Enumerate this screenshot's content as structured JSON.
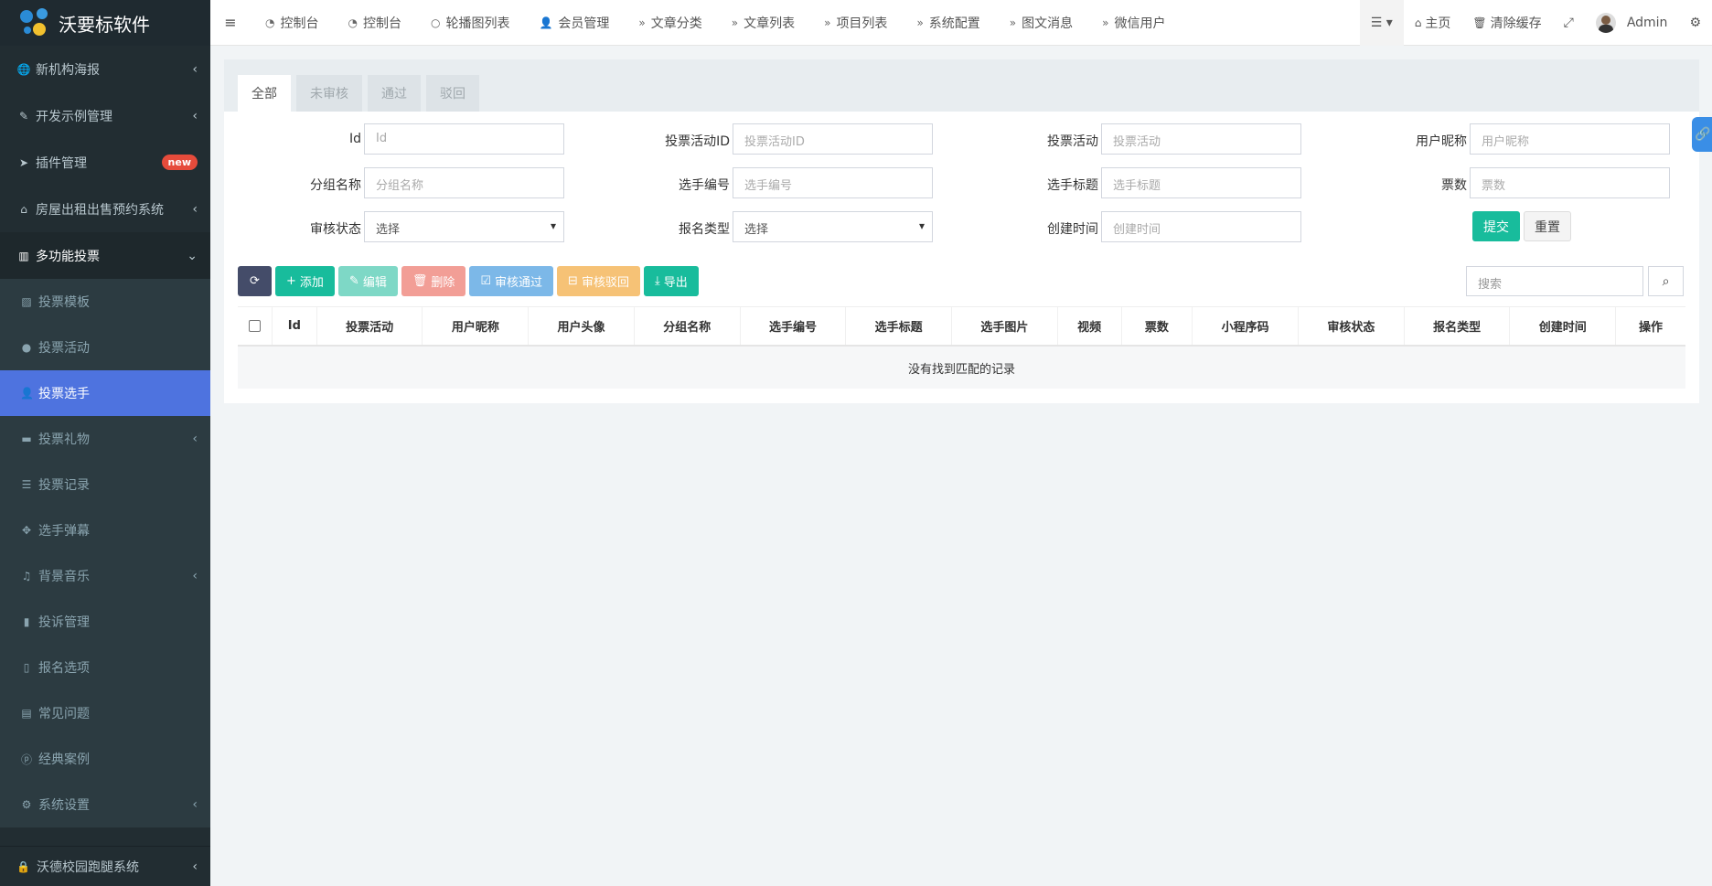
{
  "app": {
    "title": "沃要标软件"
  },
  "sidebar": {
    "items": [
      {
        "label": "新机构海报",
        "icon": "globe-icon",
        "glyph": "🌐"
      },
      {
        "label": "开发示例管理",
        "icon": "magic-icon",
        "glyph": "✎"
      },
      {
        "label": "插件管理",
        "icon": "rocket-icon",
        "glyph": "➤",
        "badge": "new"
      },
      {
        "label": "房屋出租出售预约系统",
        "icon": "home-icon",
        "glyph": "⌂"
      },
      {
        "label": "多功能投票",
        "icon": "columns-icon",
        "glyph": "▥"
      }
    ],
    "subitems": [
      {
        "label": "投票模板",
        "icon": "image-icon",
        "glyph": "▨"
      },
      {
        "label": "投票活动",
        "icon": "bomb-icon",
        "glyph": "●"
      },
      {
        "label": "投票选手",
        "icon": "user-plus-icon",
        "glyph": "👤"
      },
      {
        "label": "投票礼物",
        "icon": "archive-icon",
        "glyph": "▬"
      },
      {
        "label": "投票记录",
        "icon": "list-icon",
        "glyph": "☰"
      },
      {
        "label": "选手弹幕",
        "icon": "arrows-icon",
        "glyph": "✥"
      },
      {
        "label": "背景音乐",
        "icon": "music-icon",
        "glyph": "♫"
      },
      {
        "label": "投诉管理",
        "icon": "bookmark-icon",
        "glyph": "▮"
      },
      {
        "label": "报名选项",
        "icon": "book-icon",
        "glyph": "▯"
      },
      {
        "label": "常见问题",
        "icon": "file-word-icon",
        "glyph": "▤"
      },
      {
        "label": "经典案例",
        "icon": "product-hunt-icon",
        "glyph": "ⓟ"
      },
      {
        "label": "系统设置",
        "icon": "gear-icon",
        "glyph": "⚙"
      }
    ],
    "bottom": {
      "label": "沃德校园跑腿系统",
      "icon": "lock-icon",
      "glyph": "🔒"
    }
  },
  "topbar": {
    "tabs": [
      {
        "label": "控制台",
        "glyph": "◔"
      },
      {
        "label": "控制台",
        "glyph": "◔"
      },
      {
        "label": "轮播图列表",
        "glyph": "○"
      },
      {
        "label": "会员管理",
        "glyph": "👤"
      },
      {
        "label": "文章分类",
        "glyph": "»"
      },
      {
        "label": "文章列表",
        "glyph": "»"
      },
      {
        "label": "项目列表",
        "glyph": "»"
      },
      {
        "label": "系统配置",
        "glyph": "»"
      },
      {
        "label": "图文消息",
        "glyph": "»"
      },
      {
        "label": "微信用户",
        "glyph": "»"
      }
    ],
    "home": "主页",
    "clear_cache": "清除缓存",
    "user": "Admin"
  },
  "filter_tabs": [
    "全部",
    "未审核",
    "通过",
    "驳回"
  ],
  "form": {
    "rows": [
      [
        {
          "label": "Id",
          "placeholder": "Id"
        },
        {
          "label": "投票活动ID",
          "placeholder": "投票活动ID"
        },
        {
          "label": "投票活动",
          "placeholder": "投票活动"
        },
        {
          "label": "用户昵称",
          "placeholder": "用户昵称"
        }
      ],
      [
        {
          "label": "分组名称",
          "placeholder": "分组名称"
        },
        {
          "label": "选手编号",
          "placeholder": "选手编号"
        },
        {
          "label": "选手标题",
          "placeholder": "选手标题"
        },
        {
          "label": "票数",
          "placeholder": "票数"
        }
      ],
      [
        {
          "label": "审核状态",
          "value": "选择"
        },
        {
          "label": "报名类型",
          "value": "选择"
        },
        {
          "label": "创建时间",
          "placeholder": "创建时间"
        }
      ]
    ],
    "submit": "提交",
    "reset": "重置"
  },
  "toolbar": {
    "add": "添加",
    "edit": "编辑",
    "delete": "删除",
    "approve": "审核通过",
    "reject": "审核驳回",
    "export": "导出",
    "search_placeholder": "搜索"
  },
  "table": {
    "columns": [
      "Id",
      "投票活动",
      "用户昵称",
      "用户头像",
      "分组名称",
      "选手编号",
      "选手标题",
      "选手图片",
      "视频",
      "票数",
      "小程序码",
      "审核状态",
      "报名类型",
      "创建时间",
      "操作"
    ],
    "empty_text": "没有找到匹配的记录"
  },
  "colors": {
    "sidebar": "#222d32",
    "active": "#4e73df",
    "primary": "#18bc9c"
  }
}
